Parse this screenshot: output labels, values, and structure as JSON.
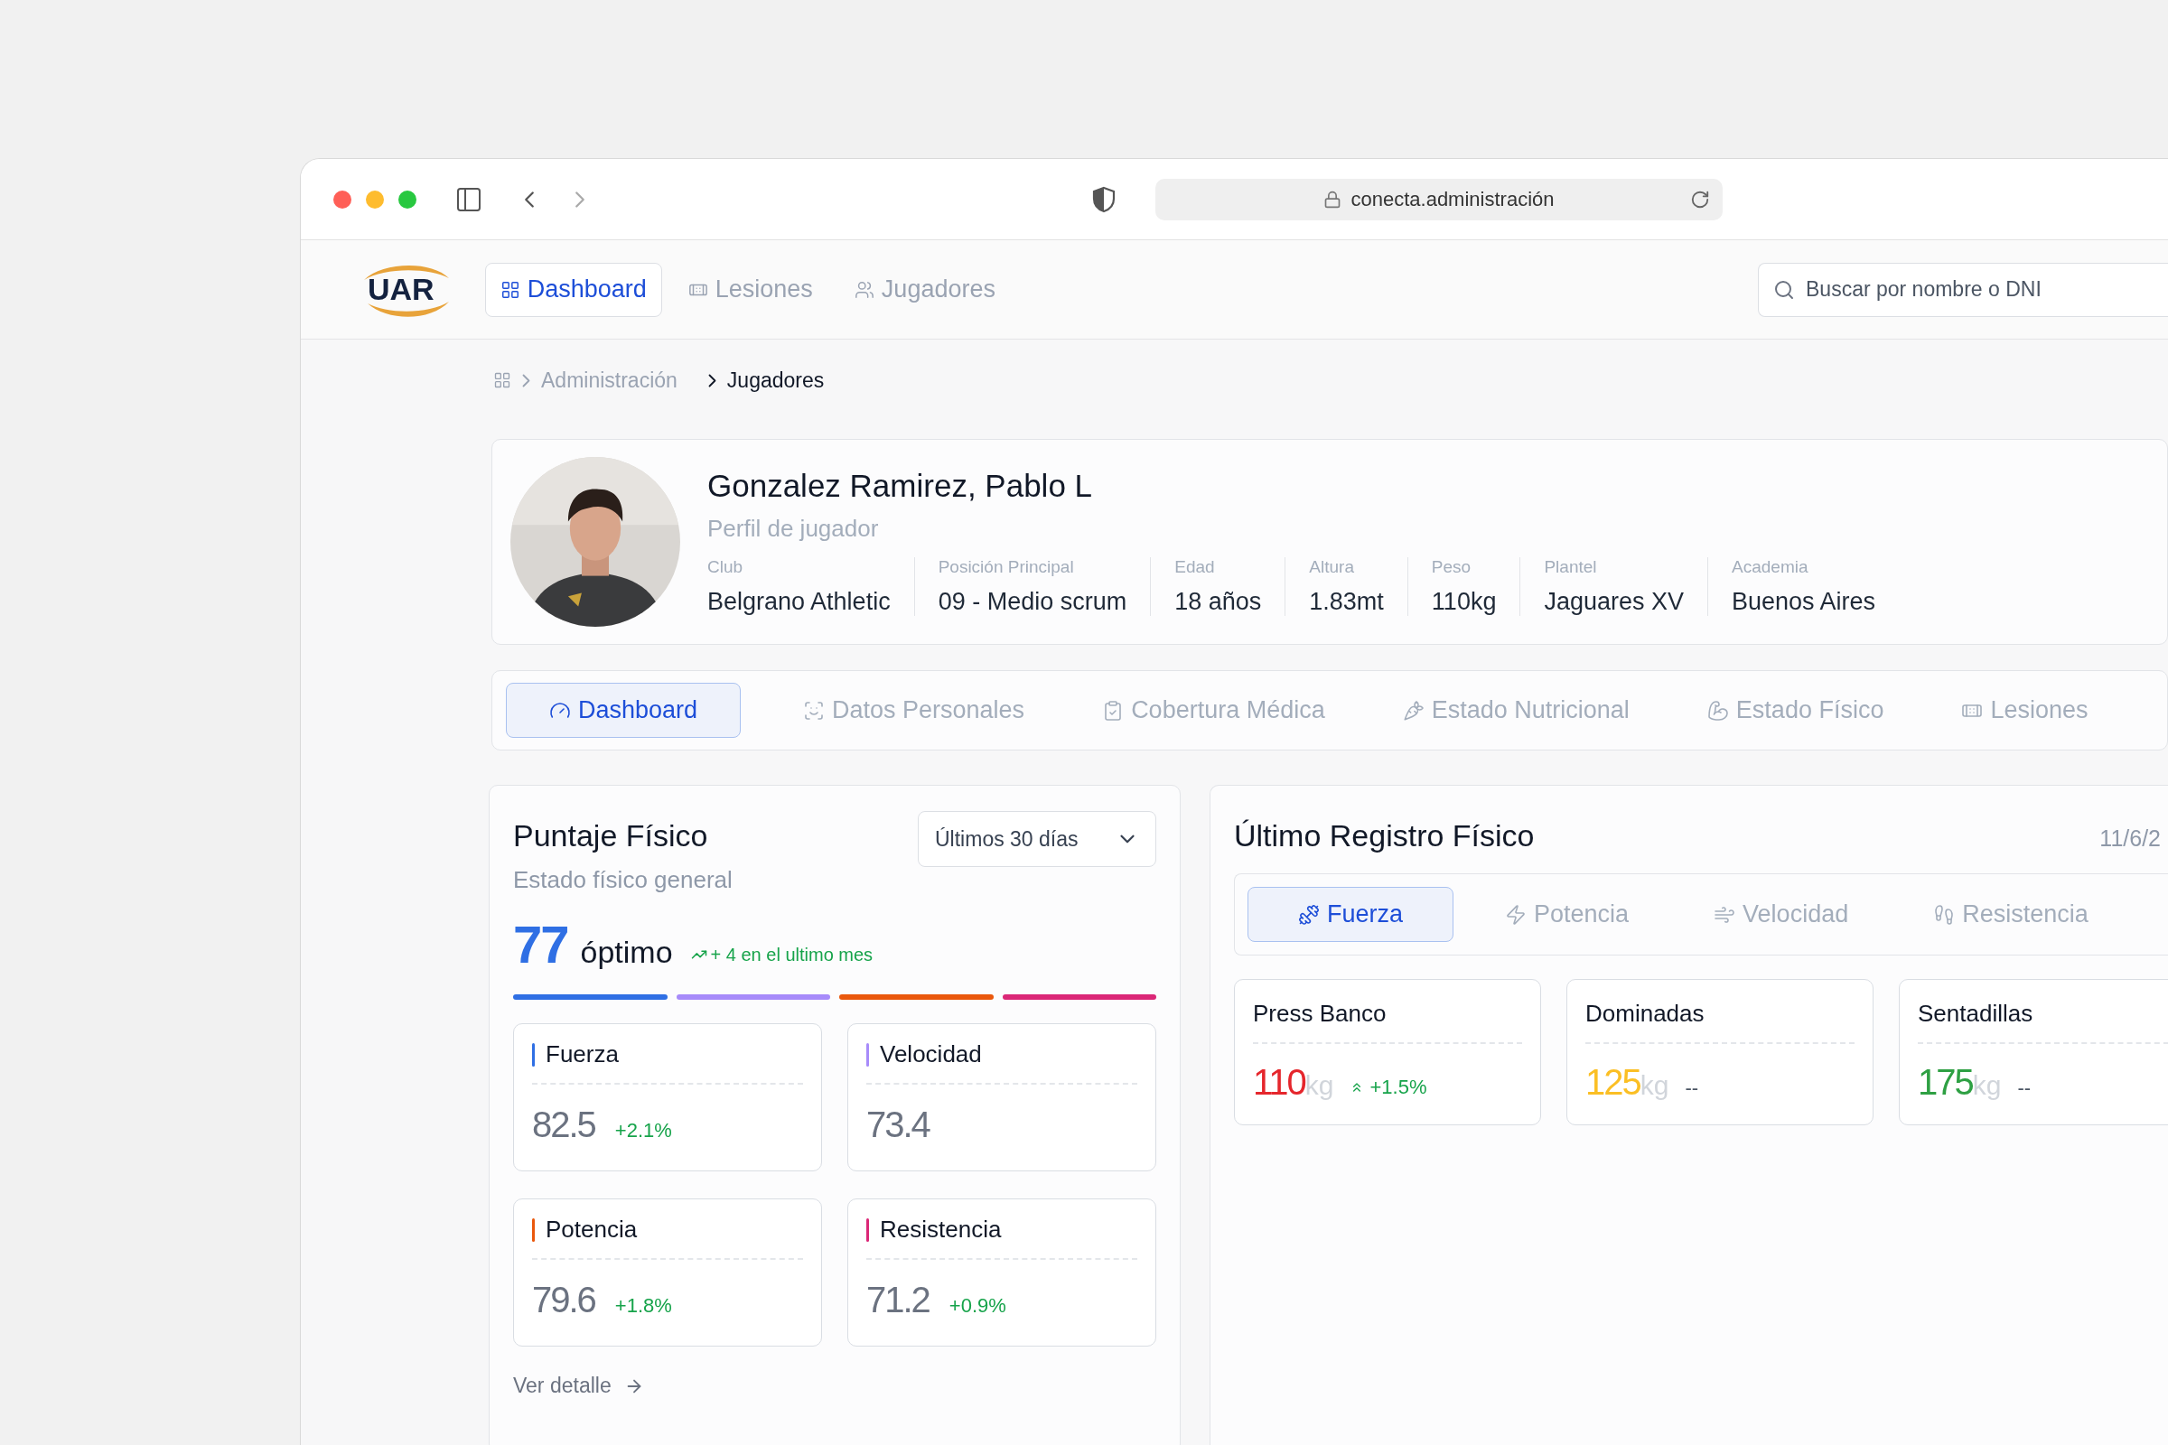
{
  "browser": {
    "url": "conecta.administración"
  },
  "header": {
    "logo": "UAR",
    "nav": [
      {
        "label": "Dashboard",
        "selected": true
      },
      {
        "label": "Lesiones",
        "selected": false
      },
      {
        "label": "Jugadores",
        "selected": false
      }
    ],
    "search": {
      "placeholder": "Buscar por nombre o DNI"
    }
  },
  "breadcrumb": [
    {
      "label": "Administración",
      "current": false
    },
    {
      "label": "Jugadores",
      "current": true
    }
  ],
  "profile": {
    "name": "Gonzalez Ramirez, Pablo L",
    "subtitle": "Perfil de jugador",
    "fields": [
      {
        "label": "Club",
        "value": "Belgrano Athletic"
      },
      {
        "label": "Posición Principal",
        "value": "09 - Medio scrum"
      },
      {
        "label": "Edad",
        "value": "18 años"
      },
      {
        "label": "Altura",
        "value": "1.83mt"
      },
      {
        "label": "Peso",
        "value": "110kg"
      },
      {
        "label": "Plantel",
        "value": "Jaguares XV"
      },
      {
        "label": "Academia",
        "value": "Buenos Aires"
      }
    ]
  },
  "tabs": [
    {
      "label": "Dashboard",
      "selected": true
    },
    {
      "label": "Datos Personales",
      "selected": false
    },
    {
      "label": "Cobertura Médica",
      "selected": false
    },
    {
      "label": "Estado Nutricional",
      "selected": false
    },
    {
      "label": "Estado Físico",
      "selected": false
    },
    {
      "label": "Lesiones",
      "selected": false
    }
  ],
  "score_card": {
    "title": "Puntaje Físico",
    "subtitle": "Estado físico general",
    "period": "Últimos 30 días",
    "score": "77",
    "rating": "óptimo",
    "trend": "+ 4 en el ultimo mes",
    "metrics": [
      {
        "name": "Fuerza",
        "value": "82.5",
        "change": "+2.1%",
        "color": "#2f6fe4"
      },
      {
        "name": "Velocidad",
        "value": "73.4",
        "color": "#a78bfa"
      },
      {
        "name": "Potencia",
        "value": "79.6",
        "change": "+1.8%",
        "color": "#ea580c"
      },
      {
        "name": "Resistencia",
        "value": "71.2",
        "change": "+0.9%",
        "color": "#db2777"
      }
    ],
    "link": "Ver detalle"
  },
  "record_card": {
    "title": "Último Registro Físico",
    "date": "11/6/2",
    "tabs": [
      {
        "label": "Fuerza",
        "selected": true
      },
      {
        "label": "Potencia",
        "selected": false
      },
      {
        "label": "Velocidad",
        "selected": false
      },
      {
        "label": "Resistencia",
        "selected": false
      }
    ],
    "exercises": [
      {
        "name": "Press Banco",
        "value": "110",
        "unit": "kg",
        "change": "+1.5%",
        "kind": "up",
        "color": "#e5262c"
      },
      {
        "name": "Dominadas",
        "value": "125",
        "unit": "kg",
        "change": "--",
        "kind": "flat",
        "color": "#fbbf24"
      },
      {
        "name": "Sentadillas",
        "value": "175",
        "unit": "kg",
        "change": "--",
        "kind": "flat",
        "color": "#2ea043"
      }
    ]
  }
}
